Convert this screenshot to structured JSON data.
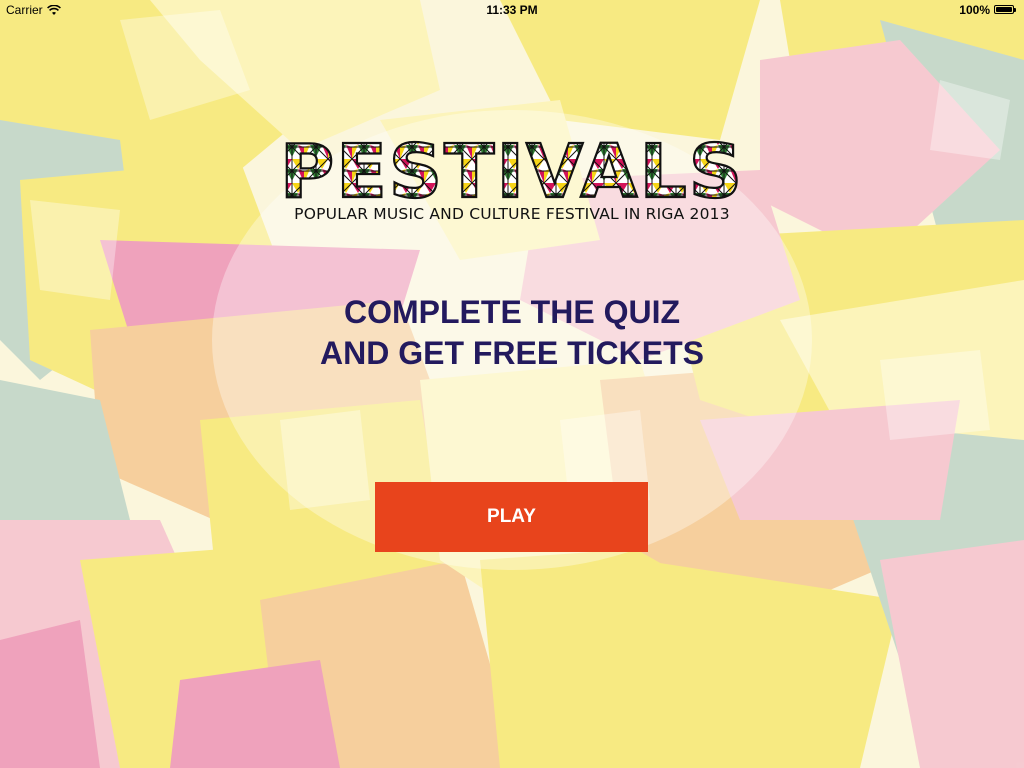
{
  "status_bar": {
    "carrier": "Carrier",
    "time": "11:33 PM",
    "battery": "100%",
    "wifi_icon": "wifi-icon",
    "battery_icon": "battery-icon"
  },
  "logo": {
    "wordmark": "PESTIVALS",
    "subtitle": "POPULAR MUSIC AND CULTURE FESTIVAL IN RIGA 2013",
    "palette": [
      "#d4145a",
      "#f7d516",
      "#2e7d32",
      "#ffffff"
    ]
  },
  "headline": {
    "line1": "COMPLETE THE QUIZ",
    "line2": "AND GET FREE TICKETS",
    "color": "#231a5e"
  },
  "play_button": {
    "label": "PLAY",
    "color": "#e8441c"
  },
  "background": {
    "colors": [
      "#f5e23a",
      "#f3a6c8",
      "#9ec3bd",
      "#f3b06a",
      "#fdf3a0",
      "#e65fa2"
    ]
  }
}
